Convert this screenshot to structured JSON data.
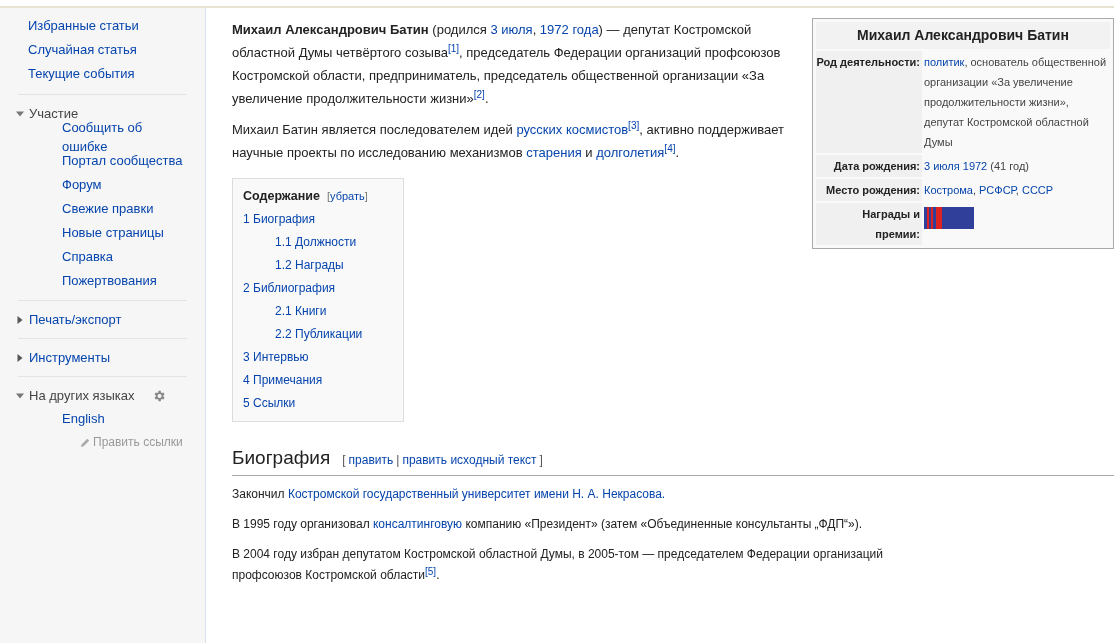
{
  "sidebar": {
    "groups": [
      {
        "kind": "plain",
        "items": [
          {
            "label": "Избранные статьи"
          },
          {
            "label": "Случайная статья"
          },
          {
            "label": "Текущие события"
          }
        ]
      },
      {
        "kind": "section",
        "heading": "Участие",
        "expanded": true,
        "items": [
          {
            "label": "Сообщить об ошибке"
          },
          {
            "label": "Портал сообщества"
          },
          {
            "label": "Форум"
          },
          {
            "label": "Свежие правки"
          },
          {
            "label": "Новые страницы"
          },
          {
            "label": "Справка"
          },
          {
            "label": "Пожертвования"
          }
        ]
      },
      {
        "kind": "section",
        "heading": "Печать/экспорт",
        "expanded": false
      },
      {
        "kind": "section",
        "heading": "Инструменты",
        "expanded": false
      },
      {
        "kind": "languages",
        "heading": "На других языках",
        "expanded": true,
        "items": [
          {
            "label": "English"
          },
          {
            "label": "Править ссылки",
            "kind": "edit"
          }
        ]
      }
    ]
  },
  "intro": [
    [
      {
        "kind": "bold",
        "t": "Михаил Александрович Батин"
      },
      {
        "kind": "text",
        "t": " (родился "
      },
      {
        "kind": "link",
        "t": "3 июля"
      },
      {
        "kind": "text",
        "t": ", "
      },
      {
        "kind": "link",
        "t": "1972 года"
      },
      {
        "kind": "text",
        "t": ") — депутат Костромской областной Думы четвёртого созыва"
      },
      {
        "kind": "ref",
        "t": "[1]"
      },
      {
        "kind": "text",
        "t": ", председатель Федерации организаций профсоюзов Костромской области, предприниматель, председатель общественной организации «За увеличение продолжительности жизни»"
      },
      {
        "kind": "ref",
        "t": "[2]"
      },
      {
        "kind": "text",
        "t": "."
      }
    ],
    [
      {
        "kind": "text",
        "t": "Михаил Батин является последователем идей "
      },
      {
        "kind": "link",
        "t": "русских космистов"
      },
      {
        "kind": "ref",
        "t": "[3]"
      },
      {
        "kind": "text",
        "t": ", активно поддерживает научные проекты по исследованию механизмов "
      },
      {
        "kind": "link",
        "t": "старения"
      },
      {
        "kind": "text",
        "t": " и "
      },
      {
        "kind": "link",
        "t": "долголетия"
      },
      {
        "kind": "ref",
        "t": "[4]"
      },
      {
        "kind": "text",
        "t": "."
      }
    ]
  ],
  "toc": {
    "title": "Содержание",
    "toggle_open": "[",
    "toggle": "убрать",
    "toggle_close": "]",
    "items": [
      {
        "label": "1 Биография",
        "children": [
          {
            "label": "1.1 Должности"
          },
          {
            "label": "1.2 Награды"
          }
        ]
      },
      {
        "label": "2 Библиография",
        "children": [
          {
            "label": "2.1 Книги"
          },
          {
            "label": "2.2 Публикации"
          }
        ]
      },
      {
        "label": "3 Интервью"
      },
      {
        "label": "4 Примечания"
      },
      {
        "label": "5 Ссылки"
      }
    ]
  },
  "infobox": {
    "title": "Михаил Александрович Батин",
    "rows": [
      {
        "kind": "text",
        "label": "Род деятельности:",
        "value": [
          {
            "kind": "link",
            "t": "политик"
          },
          {
            "kind": "text",
            "t": ", основатель общественной организации «За увеличение продолжительности жизни», депутат Костромской областной Думы"
          }
        ]
      },
      {
        "kind": "text",
        "label": "Дата рождения:",
        "value": [
          {
            "kind": "link",
            "t": "3 июля 1972"
          },
          {
            "kind": "text",
            "t": " (41 год)"
          }
        ]
      },
      {
        "kind": "text",
        "label": "Место рождения:",
        "value": [
          {
            "kind": "link",
            "t": "Кострома"
          },
          {
            "kind": "text",
            "t": ", "
          },
          {
            "kind": "link",
            "t": "РСФСР"
          },
          {
            "kind": "text",
            "t": ", "
          },
          {
            "kind": "link",
            "t": "СССР"
          }
        ]
      },
      {
        "kind": "ribbon",
        "label": "Награды и премии:"
      }
    ]
  },
  "section": {
    "heading": "Биография",
    "open": "[",
    "edit": "править",
    "separator": "|",
    "edit_source": "править исходный текст",
    "close": "]",
    "paragraphs": [
      [
        {
          "kind": "text",
          "t": "Закончил "
        },
        {
          "kind": "link",
          "t": "Костромской государственный университет имени Н. А. Некрасова."
        }
      ],
      [
        {
          "kind": "text",
          "t": "В 1995 году организовал "
        },
        {
          "kind": "link",
          "t": "консалтинговую"
        },
        {
          "kind": "text",
          "t": " компанию «Президент» (затем «Объединенные консультанты „ФДП“»)."
        }
      ],
      [
        {
          "kind": "text",
          "t": "В 2004 году избран депутатом Костромской областной Думы, в 2005-том — председателем Федерации организаций профсоюзов Костромской области"
        },
        {
          "kind": "ref",
          "t": "[5]"
        },
        {
          "kind": "text",
          "t": "."
        }
      ]
    ]
  }
}
